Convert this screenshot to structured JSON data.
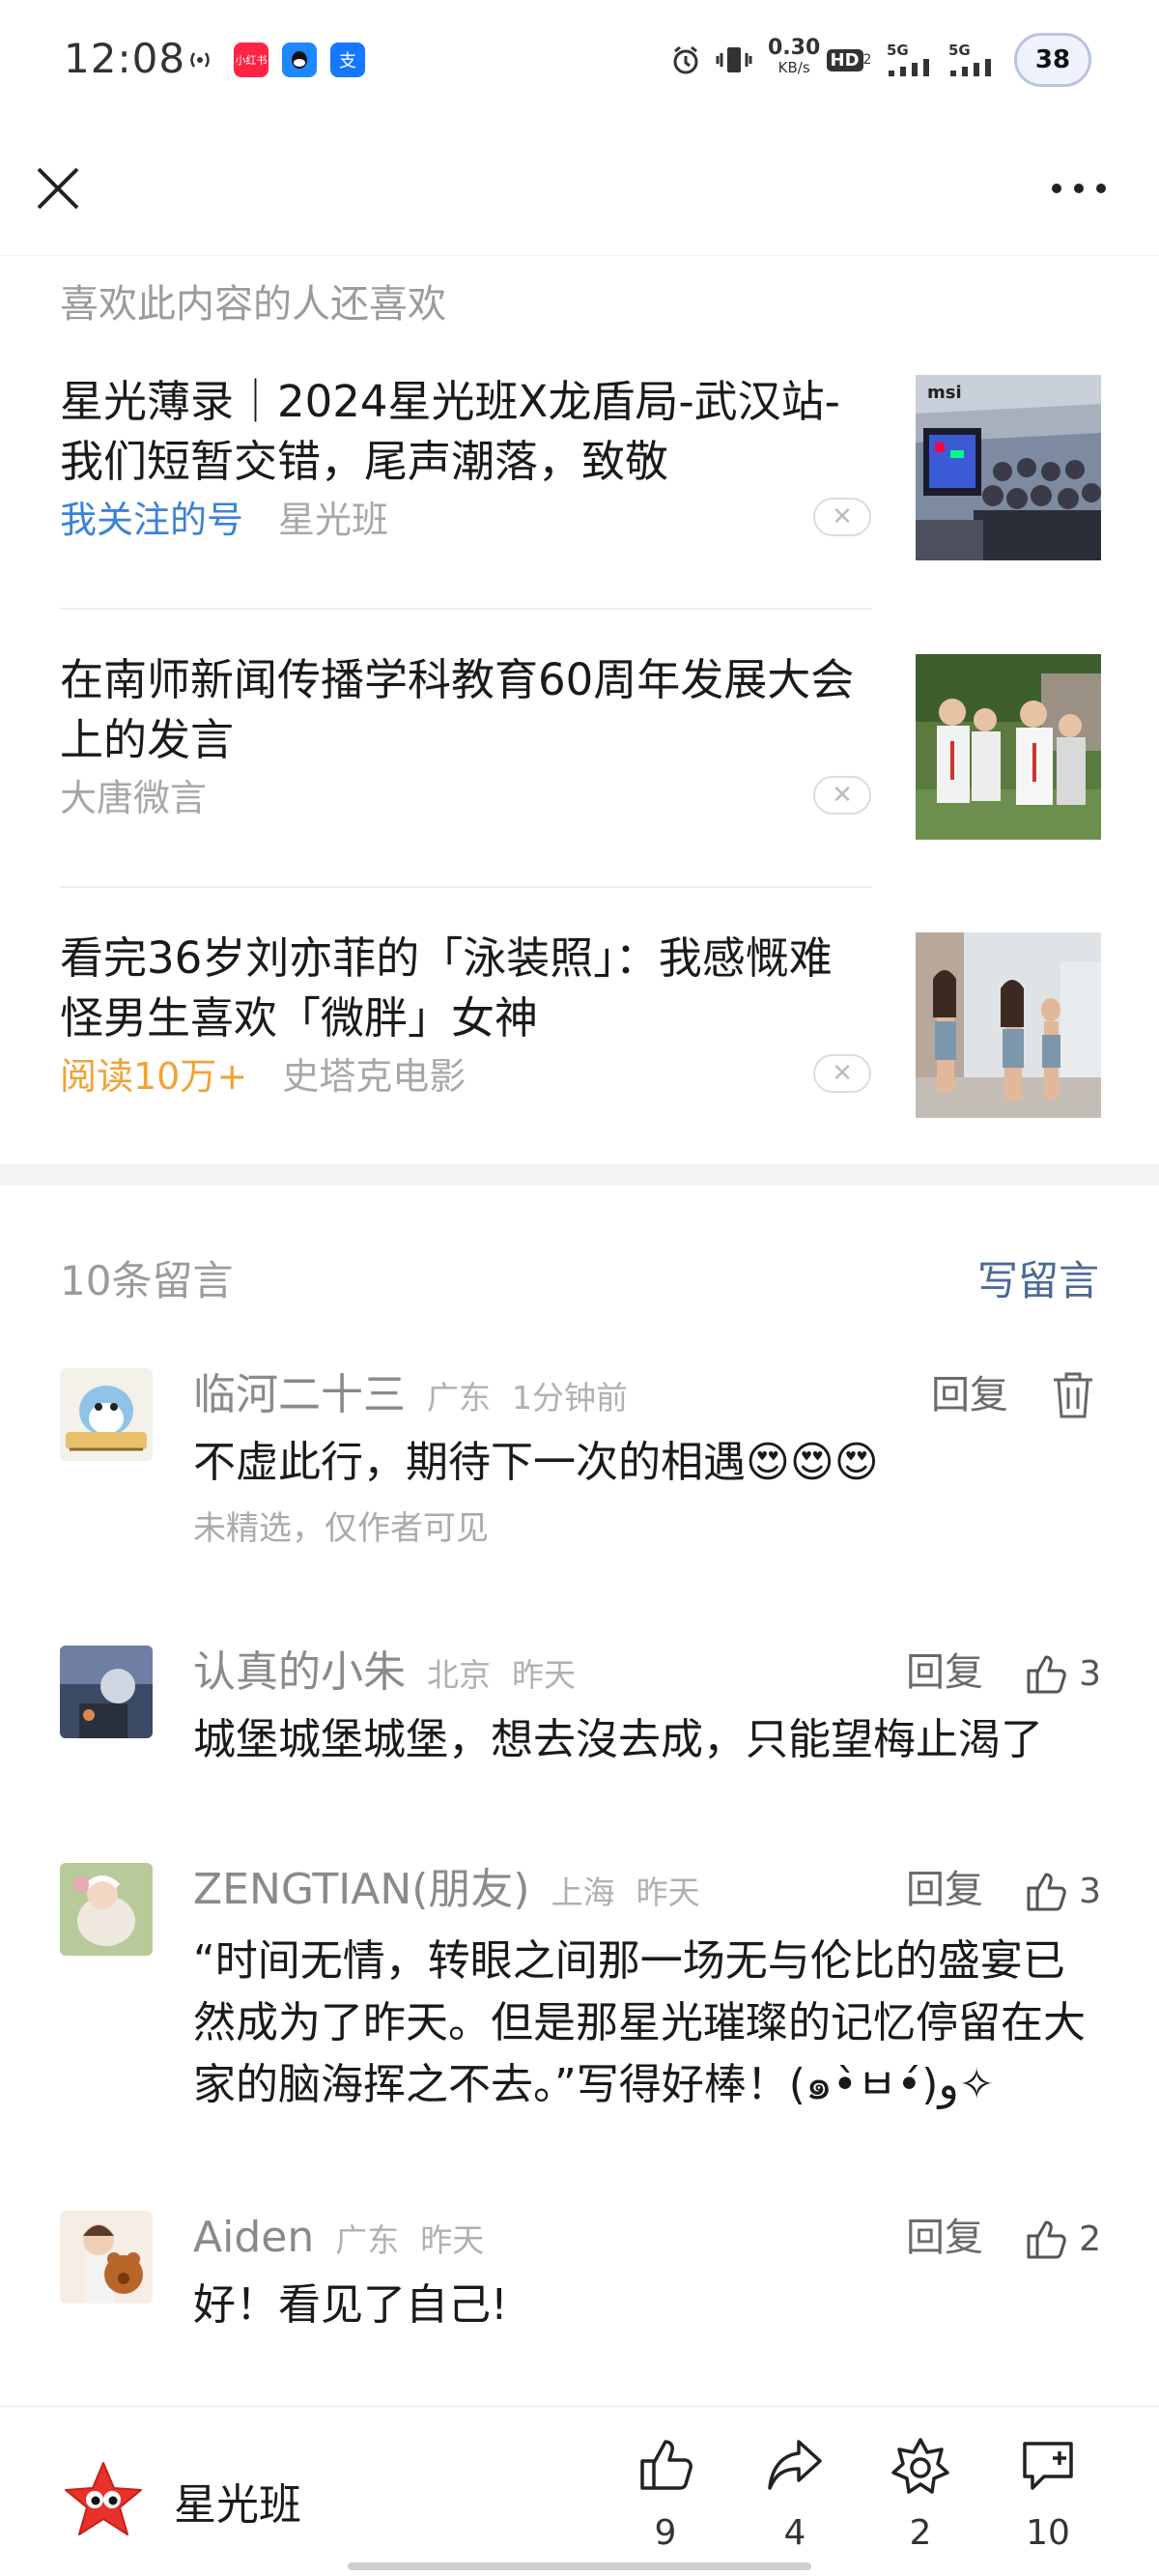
{
  "status_bar": {
    "time": "12:08",
    "app_icons": [
      "小红书",
      "QQ",
      "支"
    ],
    "net_speed_value": "0.30",
    "net_speed_unit": "KB/s",
    "hd": "HD",
    "hd_sub": "2",
    "signal_1": "5G",
    "signal_2": "5G",
    "battery": "38"
  },
  "section_title": "喜欢此内容的人还喜欢",
  "recommendations": [
    {
      "title": "星光薄录｜2024星光班X龙盾局-武汉站-我们短暂交错，尾声潮落，致敬",
      "tag": "我关注的号",
      "source": "星光班"
    },
    {
      "title": "在南师新闻传播学科教育60周年发展大会上的发言",
      "tag": "",
      "source": "大唐微言"
    },
    {
      "title": "看完36岁刘亦菲的「泳装照」：我感慨难怪男生喜欢「微胖」女神",
      "tag": "阅读10万+",
      "source": "史塔克电影"
    }
  ],
  "comments_header": {
    "count": "10条留言",
    "write": "写留言"
  },
  "comments": [
    {
      "name": "临河二十三",
      "location": "广东",
      "time": "1分钟前",
      "text": "不虚此行，期待下一次的相遇😍😍😍",
      "note": "未精选，仅作者可见",
      "reply": "回复"
    },
    {
      "name": "认真的小朱",
      "location": "北京",
      "time": "昨天",
      "text": "城堡城堡城堡，想去沒去成，只能望梅止渴了",
      "reply": "回复",
      "likes": "3"
    },
    {
      "name": "ZENGTIAN(朋友)",
      "location": "上海",
      "time": "昨天",
      "text": "“时间无情，转眼之间那一场无与伦比的盛宴已然成为了昨天。但是那星光璀璨的记忆停留在大家的脑海挥之不去。”写得好棒！(๑•̀ㅂ•́)و✧",
      "reply": "回复",
      "likes": "3"
    },
    {
      "name": "Aiden",
      "location": "广东",
      "time": "昨天",
      "text": "好！看见了自己!",
      "reply": "回复",
      "likes": "2"
    }
  ],
  "bottom_bar": {
    "account_name": "星光班",
    "like_count": "9",
    "share_count": "4",
    "wow_count": "2",
    "comment_count": "10"
  },
  "colors": {
    "link_blue": "#3a82d8",
    "read_orange": "#f2a235",
    "write_comment": "#4b6a95",
    "logo_red": "#e8312a"
  }
}
